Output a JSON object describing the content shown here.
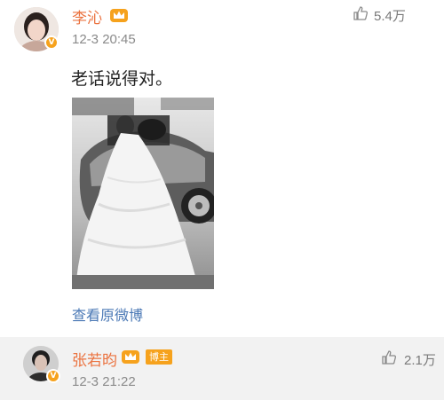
{
  "post": {
    "username": "李沁",
    "verified_badge": "V",
    "time": "12-3 20:45",
    "likes": "5.4万",
    "content": "老话说得对。",
    "view_original": "查看原微博",
    "icons": {
      "avatar": "avatar",
      "crown": "crown-icon",
      "like": "thumbs-up-icon"
    },
    "accent_color": "#eb7340",
    "link_color": "#4a78b5"
  },
  "reply": {
    "username": "张若昀",
    "verified_badge": "V",
    "tag": "博主",
    "time": "12-3 21:22",
    "likes": "2.1万",
    "icons": {
      "avatar": "avatar",
      "crown": "crown-icon",
      "like": "thumbs-up-icon"
    }
  }
}
